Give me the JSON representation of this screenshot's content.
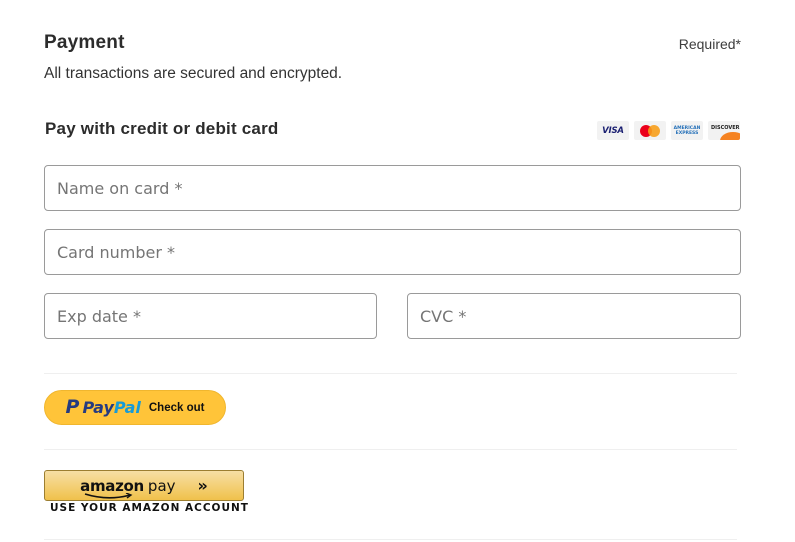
{
  "header": {
    "title": "Payment",
    "required_note": "Required*",
    "subtitle": "All transactions are secured and encrypted."
  },
  "card_section": {
    "heading": "Pay with credit or debit card",
    "accepted_cards": [
      {
        "name": "VISA",
        "icon": "visa-logo-icon"
      },
      {
        "name": "Mastercard",
        "icon": "mastercard-logo-icon"
      },
      {
        "name": "AMERICAN EXPRESS",
        "icon": "amex-logo-icon"
      },
      {
        "name": "DISCOVER",
        "icon": "discover-logo-icon"
      }
    ],
    "fields": {
      "name_on_card": {
        "placeholder": "Name on card *",
        "value": ""
      },
      "card_number": {
        "placeholder": "Card number *",
        "value": ""
      },
      "exp_date": {
        "placeholder": "Exp date *",
        "value": ""
      },
      "cvc": {
        "placeholder": "CVC *",
        "value": ""
      }
    }
  },
  "paypal": {
    "brand_pay": "Pay",
    "brand_pal": "Pal",
    "label": "Check out",
    "colors": {
      "button": "#ffc439",
      "dark_blue": "#253b80",
      "light_blue": "#179bd7"
    }
  },
  "amazon_pay": {
    "brand": "amazon",
    "pay": "pay",
    "chevrons": "»",
    "caption": "USE YOUR AMAZON ACCOUNT",
    "colors": {
      "button": "#f0c14b",
      "border": "#9c7e31"
    }
  }
}
